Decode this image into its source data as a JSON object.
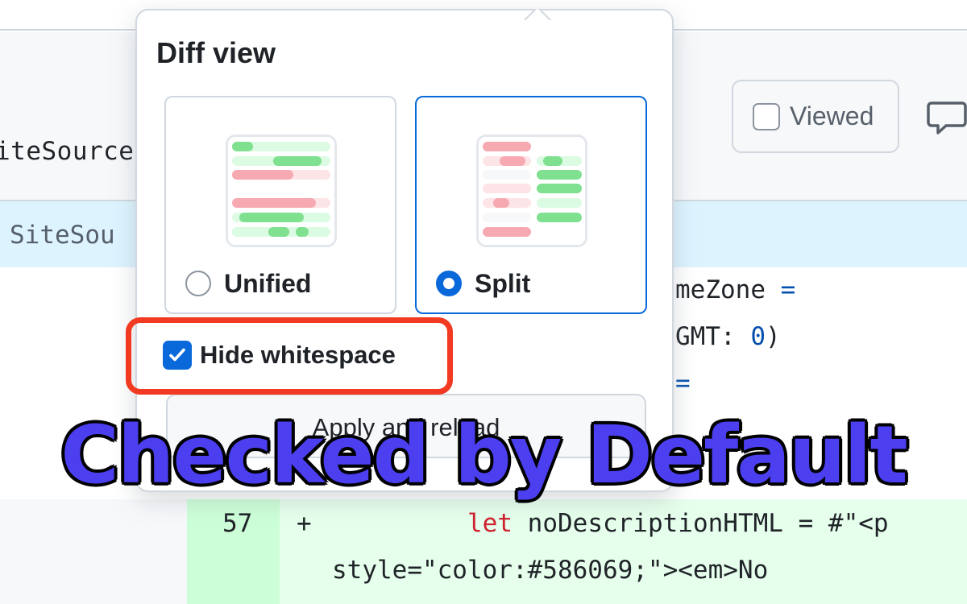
{
  "file_header": {
    "filename_fragment": "iteSource",
    "viewed_label": "Viewed",
    "comment_icon": "comment-icon"
  },
  "hunk": {
    "text": "SiteSou"
  },
  "code": {
    "line1": [
      "meZone ",
      "="
    ],
    "line2": [
      "GMT: ",
      "0",
      ")"
    ],
    "line3": [
      "="
    ],
    "line4": [
      "",
      "",
      "()"
    ],
    "added_line_number": "57",
    "added_marker": "+",
    "added_line_keyword": "let",
    "added_line_rest": " noDescriptionHTML = #\"<p",
    "added_line_cont": "style=\"color:#586069;\"><em>No"
  },
  "popover": {
    "title": "Diff view",
    "options": [
      {
        "label": "Unified",
        "selected": false
      },
      {
        "label": "Split",
        "selected": true
      }
    ],
    "hide_whitespace_label": "Hide whitespace",
    "hide_whitespace_checked": true,
    "apply_label": "Apply and reload"
  },
  "overlay": {
    "headline": "Checked by Default",
    "highlight_color": "#f23a22",
    "headline_color": "#4b3ff0"
  },
  "colors": {
    "accent": "#0969da",
    "added_bg": "#e6ffec",
    "added_num_bg": "#ccffd8",
    "hunk_bg": "#ddf4ff"
  }
}
